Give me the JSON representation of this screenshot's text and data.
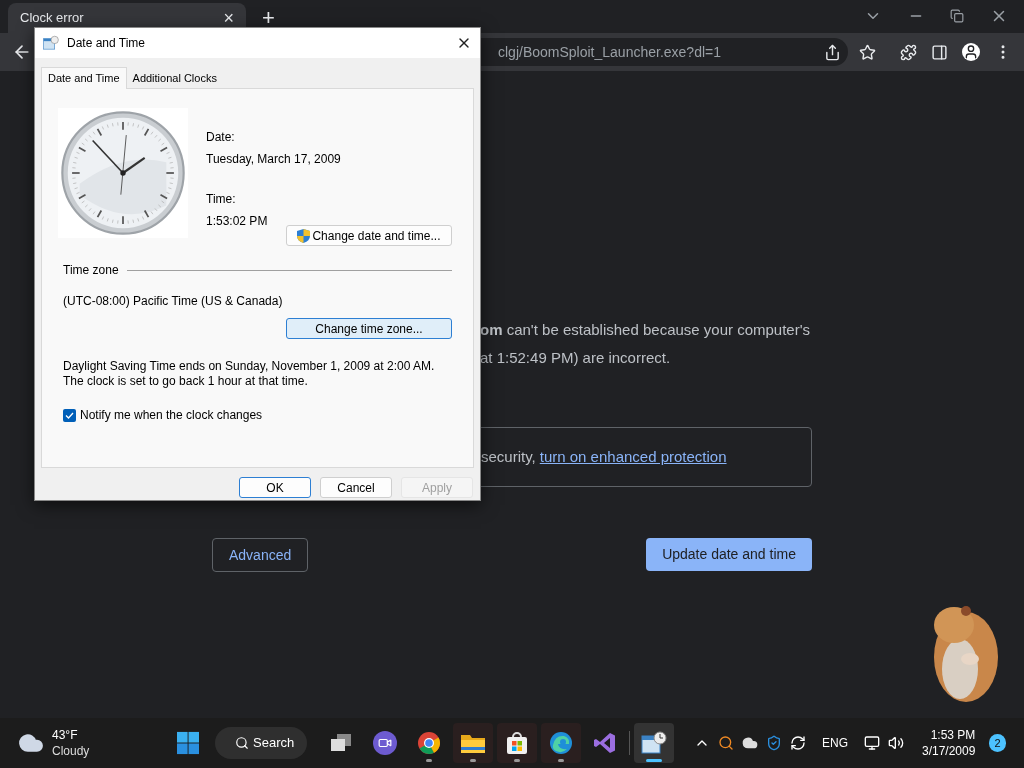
{
  "browser": {
    "tab": {
      "title": "Clock error",
      "close": "×"
    },
    "new_tab": "+",
    "address": "clgj/BoomSploit_Launcher.exe?dl=1",
    "page": {
      "message_lines": [
        "**om** can't be established because your computer's",
        "at 1:52:49 PM) are incorrect."
      ],
      "protection_text": "security,",
      "protection_link": "turn on enhanced protection",
      "advanced_button": "Advanced",
      "update_button": "Update date and time"
    }
  },
  "dialog": {
    "title": "Date and Time",
    "tabs": [
      {
        "label": "Date and Time",
        "selected": true
      },
      {
        "label": "Additional Clocks",
        "selected": false
      }
    ],
    "date_label": "Date:",
    "date": "Tuesday, March 17, 2009",
    "time_label": "Time:",
    "time": "1:53:02 PM",
    "change_datetime_button": "Change date and time...",
    "timezone_group": "Time zone",
    "timezone": "(UTC-08:00) Pacific Time (US & Canada)",
    "change_timezone_button": "Change time zone...",
    "dst_note": "Daylight Saving Time ends on Sunday, November 1, 2009 at 2:00 AM. The clock is set to go back 1 hour at that time.",
    "notify": {
      "label": "Notify me when the clock changes",
      "checked": true
    },
    "buttons": [
      {
        "label": "OK",
        "default": true,
        "disabled": false
      },
      {
        "label": "Cancel",
        "default": false,
        "disabled": false
      },
      {
        "label": "Apply",
        "default": false,
        "disabled": true
      }
    ]
  },
  "taskbar": {
    "weather": {
      "temperature": "43°F",
      "condition": "Cloudy"
    },
    "search": "Search",
    "apps": [
      {
        "kind": "taskview",
        "running": false,
        "active": false
      },
      {
        "kind": "meet",
        "running": false,
        "active": false
      },
      {
        "kind": "chrome",
        "running": true,
        "active": false
      },
      {
        "kind": "explorer",
        "running": true,
        "active": false
      },
      {
        "kind": "store",
        "running": true,
        "active": false
      },
      {
        "kind": "edge",
        "running": true,
        "active": false
      },
      {
        "kind": "vs",
        "running": false,
        "active": false
      },
      {
        "kind": "datetime",
        "running": true,
        "active": true
      }
    ],
    "language": "ENG",
    "time": "1:53 PM",
    "date": "3/17/2009",
    "notifications": "2"
  }
}
